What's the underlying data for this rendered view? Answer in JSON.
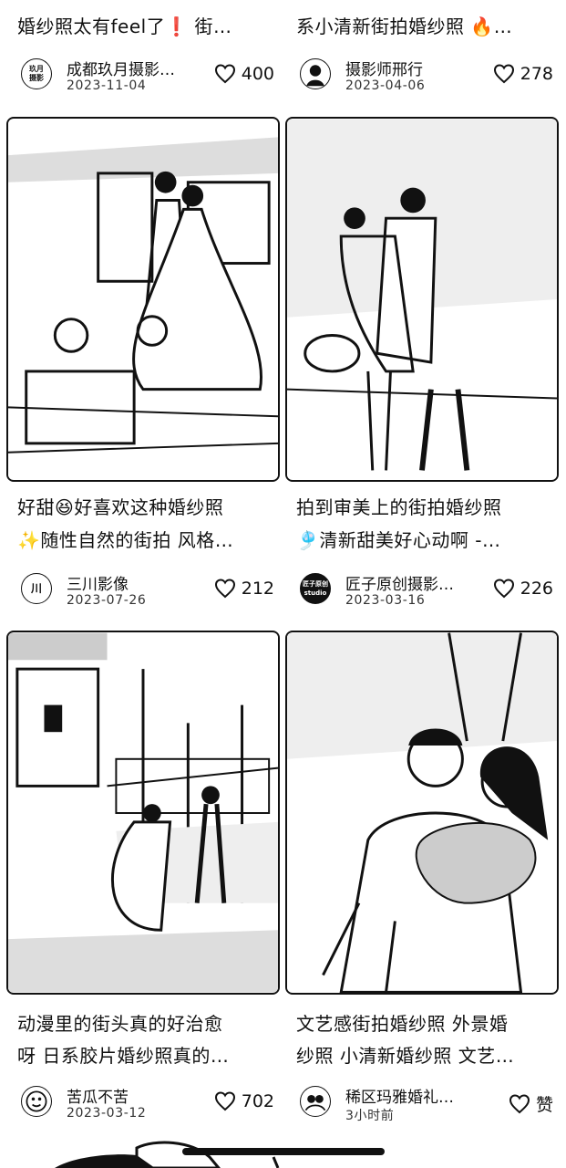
{
  "top_partial": [
    {
      "title": "婚纱照太有feel了❗ 街…",
      "author": "成都玖月摄影…",
      "avatar_text": "玖月\n摄影",
      "date": "2023-11-04",
      "likes": "400"
    },
    {
      "title": "系小清新街拍婚纱照 🔥…",
      "author": "摄影师邢行",
      "avatar_text": "",
      "date": "2023-04-06",
      "likes": "278"
    }
  ],
  "cards": [
    {
      "title_line1": "好甜😆好喜欢这种婚纱照",
      "title_line2": "✨随性自然的街拍 风格…",
      "author": "三川影像",
      "avatar_text": "川",
      "date": "2023-07-26",
      "likes": "212"
    },
    {
      "title_line1": "拍到审美上的街拍婚纱照",
      "title_line2": "🎐清新甜美好心动啊 -…",
      "author": "匠子原创摄影…",
      "avatar_text": "匠子原创\nstudio",
      "date": "2023-03-16",
      "likes": "226"
    },
    {
      "title_line1": "动漫里的街头真的好治愈",
      "title_line2": "呀 日系胶片婚纱照真的…",
      "author": "苦瓜不苦",
      "avatar_text": "",
      "date": "2023-03-12",
      "likes": "702"
    },
    {
      "title_line1": "文艺感街拍婚纱照 外景婚",
      "title_line2": "纱照 小清新婚纱照 文艺…",
      "author": "稀区玛雅婚礼…",
      "avatar_text": "",
      "date": "3小时前",
      "likes": "赞"
    }
  ]
}
